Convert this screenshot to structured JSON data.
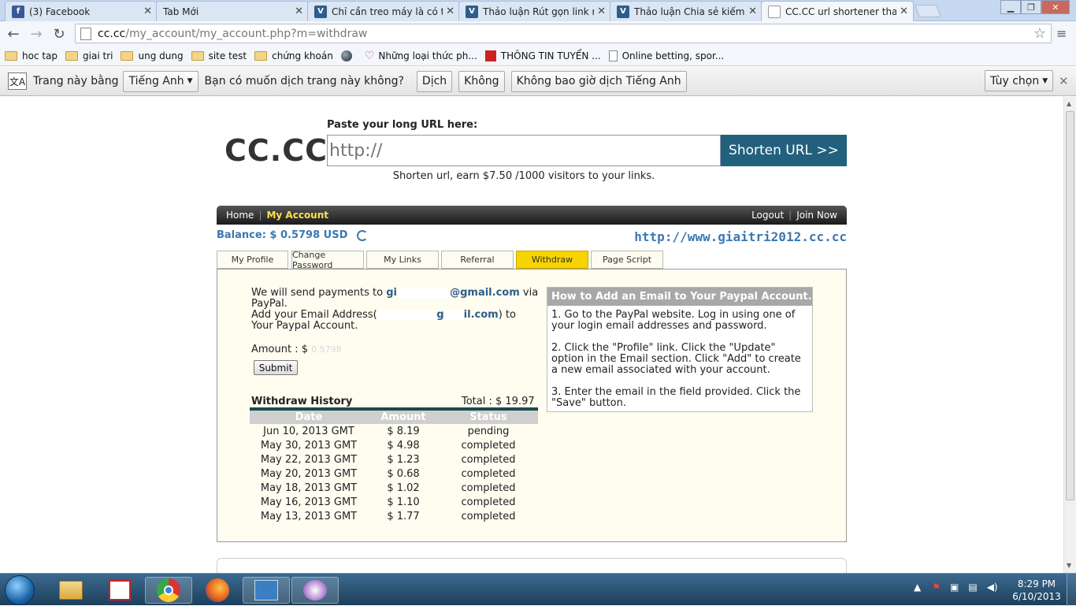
{
  "browser": {
    "tabs": [
      {
        "title": "(3) Facebook",
        "icon": "facebook-icon",
        "color": "#3b5998"
      },
      {
        "title": "Tab Mới",
        "icon": "none"
      },
      {
        "title": "Chỉ cần treo máy là có tiền",
        "icon": "vbulletin-icon",
        "color": "#2d5d8b"
      },
      {
        "title": "Thảo luận Rút gọn link rất",
        "icon": "vbulletin-icon",
        "color": "#2d5d8b"
      },
      {
        "title": "Thảo luận Chia sẻ kiếm tiền",
        "icon": "vbulletin-icon",
        "color": "#2d5d8b"
      },
      {
        "title": "CC.CC url shortener that pay",
        "icon": "page-icon"
      }
    ],
    "url": {
      "host": "cc.cc",
      "path": "/my_account/my_account.php?m=withdraw"
    },
    "bookmarks": [
      {
        "label": "hoc tap",
        "icon": "folder-icon"
      },
      {
        "label": "giai tri",
        "icon": "folder-icon"
      },
      {
        "label": "ung dung",
        "icon": "folder-icon"
      },
      {
        "label": "site test",
        "icon": "folder-icon"
      },
      {
        "label": "chứng khoán",
        "icon": "folder-icon"
      },
      {
        "label": "",
        "icon": "globe-icon"
      },
      {
        "label": "Những loại thức ph...",
        "icon": "heart-icon"
      },
      {
        "label": "THÔNG TIN TUYỂN ...",
        "icon": "news-icon"
      },
      {
        "label": "Online betting, spor...",
        "icon": "page-icon"
      }
    ],
    "translate": {
      "prefix": "Trang này bằng",
      "language": "Tiếng Anh",
      "question": "Bạn có muốn dịch trang này không?",
      "translate_btn": "Dịch",
      "no_btn": "Không",
      "never_btn": "Không bao giờ dịch Tiếng Anh",
      "options_btn": "Tùy chọn"
    }
  },
  "site": {
    "logo": "CC.CC",
    "paste_label": "Paste your long URL here:",
    "url_placeholder": "http://",
    "shorten_button": "Shorten URL >>",
    "tagline": "Shorten url, earn $7.50 /1000 visitors to your links.",
    "nav": {
      "home": "Home",
      "my_account": "My Account",
      "logout": "Logout",
      "join": "Join Now"
    },
    "balance": "Balance: $ 0.5798 USD",
    "site_link": "http://www.giaitri2012.cc.cc",
    "tabs": [
      "My Profile",
      "Change Password",
      "My Links",
      "Referral",
      "Withdraw",
      "Page Script"
    ],
    "active_tab": "Withdraw",
    "withdraw": {
      "send_pre": "We will send payments to",
      "email_a": "gi",
      "email_b": "@gmail.com",
      "send_post": "via PayPal.",
      "add_pre": "Add your Email Address(",
      "add_email_a": "g",
      "add_email_b": "il.com",
      "add_post": ") to Your Paypal Account.",
      "amount_label": "Amount : $",
      "amount_value": "0.5798",
      "submit": "Submit"
    },
    "history": {
      "title": "Withdraw History",
      "total": "Total : $ 19.97",
      "columns": [
        "Date",
        "Amount",
        "Status"
      ],
      "rows": [
        {
          "date": "Jun 10, 2013 GMT",
          "amount": "$ 8.19",
          "status": "pending"
        },
        {
          "date": "May 30, 2013 GMT",
          "amount": "$ 4.98",
          "status": "completed"
        },
        {
          "date": "May 22, 2013 GMT",
          "amount": "$ 1.23",
          "status": "completed"
        },
        {
          "date": "May 20, 2013 GMT",
          "amount": "$ 0.68",
          "status": "completed"
        },
        {
          "date": "May 18, 2013 GMT",
          "amount": "$ 1.02",
          "status": "completed"
        },
        {
          "date": "May 16, 2013 GMT",
          "amount": "$ 1.10",
          "status": "completed"
        },
        {
          "date": "May 13, 2013 GMT",
          "amount": "$ 1.77",
          "status": "completed"
        }
      ]
    },
    "howto": {
      "title": "How to Add an Email to Your Paypal Account.",
      "steps": [
        "1. Go to the PayPal website. Log in using one of your login email addresses and password.",
        "2. Click the \"Profile\" link. Click the \"Update\" option in the Email section. Click \"Add\" to create a new email associated with your account.",
        "3. Enter the email in the field provided. Click the \"Save\" button."
      ]
    }
  },
  "taskbar": {
    "time": "8:29 PM",
    "date": "6/10/2013"
  }
}
